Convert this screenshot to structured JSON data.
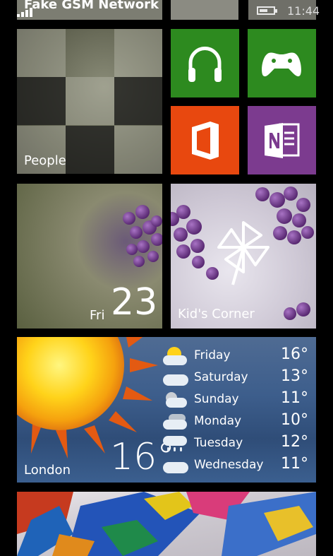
{
  "status_bar": {
    "network": "Fake GSM Network",
    "time": "11:44",
    "battery_level": 0.6
  },
  "tiles": {
    "people": {
      "label": "People"
    },
    "music": {
      "icon": "headphones-icon",
      "color": "#2d8a1f"
    },
    "xbox": {
      "icon": "xbox-controller-icon",
      "color": "#2d8a1f"
    },
    "office": {
      "icon": "office-icon",
      "color": "#e8480f"
    },
    "onenote": {
      "icon": "onenote-icon",
      "color": "#7c3b8f"
    },
    "calendar": {
      "day": "Fri",
      "date": "23"
    },
    "kids_corner": {
      "label": "Kid's Corner",
      "icon": "pinwheel-icon"
    },
    "weather": {
      "city": "London",
      "current_temp": "16°",
      "forecast": [
        {
          "day": "Friday",
          "temp": "16°",
          "icon": "partly-sunny-icon"
        },
        {
          "day": "Saturday",
          "temp": "13°",
          "icon": "cloud-icon"
        },
        {
          "day": "Sunday",
          "temp": "11°",
          "icon": "partly-cloudy-icon"
        },
        {
          "day": "Monday",
          "temp": "10°",
          "icon": "cloudy-icon"
        },
        {
          "day": "Tuesday",
          "temp": "12°",
          "icon": "rain-icon"
        },
        {
          "day": "Wednesday",
          "temp": "11°",
          "icon": "cloud-icon"
        }
      ]
    },
    "painting": {
      "label": ""
    }
  }
}
